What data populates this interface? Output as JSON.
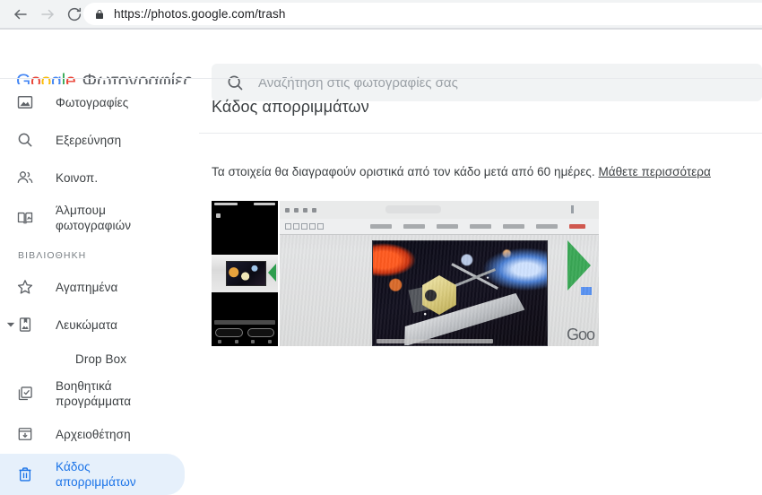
{
  "browser": {
    "back_icon": "back-arrow-icon",
    "forward_icon": "forward-arrow-icon",
    "reload_icon": "reload-icon",
    "lock_icon": "lock-icon",
    "url": "https://photos.google.com/trash"
  },
  "header": {
    "logo_letters": [
      "G",
      "o",
      "o",
      "g",
      "l",
      "e"
    ],
    "brand_word": "Φωτογραφίες",
    "search": {
      "icon": "search-icon",
      "placeholder": "Αναζήτηση στις φωτογραφίες σας",
      "value": ""
    }
  },
  "sidebar": {
    "items": [
      {
        "icon": "photo-icon",
        "label": "Φωτογραφίες"
      },
      {
        "icon": "search-icon",
        "label": "Εξερεύνηση"
      },
      {
        "icon": "people-icon",
        "label": "Κοινοπ."
      },
      {
        "icon": "album-book-icon",
        "label": "Άλμπουμ φωτογραφιών"
      }
    ],
    "library_label": "ΒΙΒΛΙΟΘΗΚΗ",
    "library_items": [
      {
        "icon": "star-icon",
        "label": "Αγαπημένα"
      },
      {
        "icon": "albums-bookmark-icon",
        "label": "Λευκώματα",
        "expander": "chevron-down-icon"
      },
      {
        "icon": "utilities-icon",
        "label": "Βοηθητικά προγράμματα"
      },
      {
        "icon": "archive-icon",
        "label": "Αρχειοθέτηση"
      },
      {
        "icon": "trash-icon",
        "label": "Κάδος απορριμμάτων",
        "active": true
      }
    ],
    "sub_item": {
      "label": "Drop Box"
    }
  },
  "main": {
    "page_title": "Κάδος απορριμμάτων",
    "notice_text": "Τα στοιχεία θα διαγραφούν οριστικά από τον κάδο μετά από 60 ημέρες.",
    "notice_link": "Μάθετε περισσότερα",
    "thumbnails": [
      {
        "name": "phone-screenshot-thumbnail"
      },
      {
        "name": "monitor-photo-thumbnail",
        "overlay_text": "Goo"
      }
    ]
  },
  "colors": {
    "accent_blue": "#1a73e8",
    "active_pill": "#e6f0fb",
    "google_blue": "#4285f4",
    "google_red": "#ea4335",
    "google_yellow": "#fbbc05",
    "google_green": "#34a853",
    "text_primary": "#3c4043",
    "text_muted": "#9aa0a6"
  }
}
